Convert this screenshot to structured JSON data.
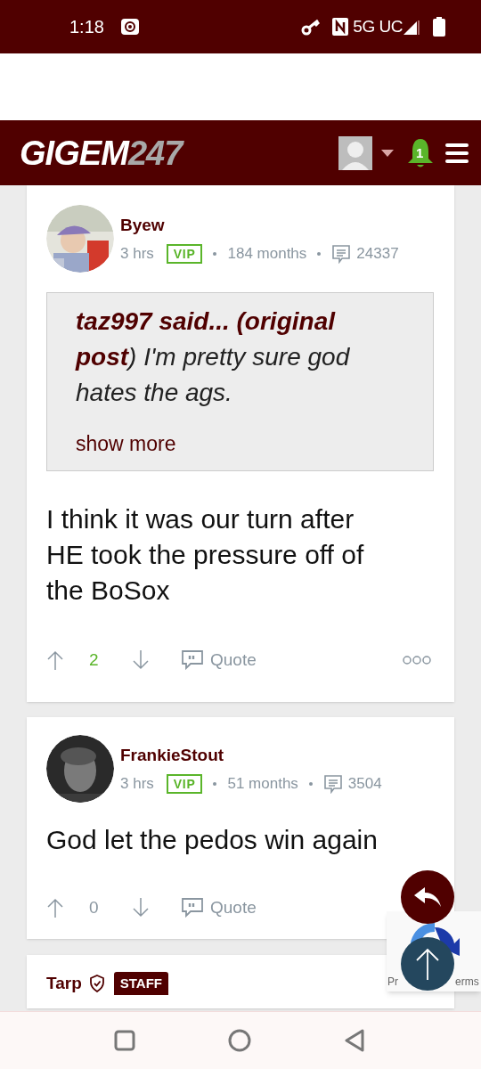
{
  "status_bar": {
    "time": "1:18",
    "network": "5G UC"
  },
  "header": {
    "logo_main": "GIGEM",
    "logo_accent": "247",
    "notification_count": "1"
  },
  "posts": [
    {
      "kind": "member",
      "author": "Byew",
      "time": "3 hrs",
      "badge": "VIP",
      "tenure": "184 months",
      "post_count": "24337",
      "quote": {
        "text": "**taz997 said... (original post**) I'm pretty sure god hates the ags.",
        "show_more": "show more"
      },
      "body": "I think it was our turn after HE took the pressure off of the BoSox",
      "score": "2",
      "upvoted": true,
      "quote_label": "Quote",
      "more_menu": true
    },
    {
      "kind": "member",
      "author": "FrankieStout",
      "time": "3 hrs",
      "badge": "VIP",
      "tenure": "51 months",
      "post_count": "3504",
      "body": "God let the pedos win again",
      "score": "0",
      "upvoted": false,
      "quote_label": "Quote",
      "more_menu": false
    },
    {
      "kind": "staff",
      "author": "Tarp",
      "badge": "STAFF"
    }
  ],
  "recaptcha": {
    "left_text": "Pr",
    "right_text": "erms"
  }
}
